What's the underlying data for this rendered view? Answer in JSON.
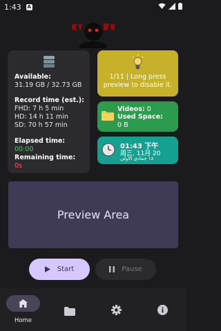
{
  "status_bar": {
    "time": "1:43",
    "notification_badge": "A"
  },
  "storage": {
    "available_label": "Available:",
    "available_value": "31.19 GB / 32.73 GB",
    "record_label": "Record time (est.):",
    "fhd": "FHD: 7 h 5 min",
    "hd": "HD: 14 h 11 min",
    "sd": "SD: 70 h 57 min",
    "elapsed_label": "Elapsed time:",
    "elapsed_value": "00:00",
    "remaining_label": "Remaining time:",
    "remaining_value": "0s"
  },
  "tip": {
    "text_line1": "1/11 | Long press",
    "text_line2": "preview to disable it."
  },
  "videos": {
    "videos_label": "Videos:",
    "videos_value": "0",
    "used_label": "Used Space:",
    "used_value": "0 B"
  },
  "clock": {
    "time": "01:43 下午",
    "date": "周三, 11月 20",
    "hijri": "١٨ جمادى الأولى"
  },
  "preview": {
    "label": "Preview Area"
  },
  "controls": {
    "start_label": "Start",
    "pause_label": "Pause"
  },
  "nav": {
    "home_label": "Home"
  },
  "colors": {
    "background": "#1b1a1d",
    "tip_card": "#c7b12a",
    "videos_card": "#2d9b4e",
    "clock_card": "#15a192",
    "preview": "#3f3a56",
    "start_button": "#d6c8ff",
    "elapsed": "#46d35c",
    "remaining": "#ff5a3c"
  }
}
